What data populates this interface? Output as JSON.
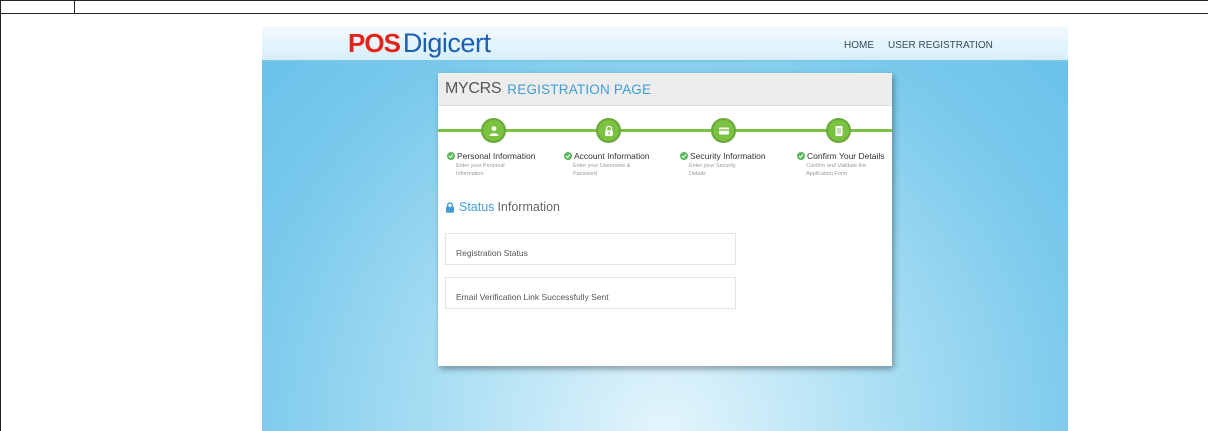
{
  "site": {
    "logo_pos": "POS",
    "logo_digicert": "Digicert"
  },
  "nav": {
    "home": "HOME",
    "user_registration": "USER REGISTRATION"
  },
  "page": {
    "title_main": "MYCRS",
    "title_sub": "REGISTRATION PAGE"
  },
  "steps": [
    {
      "title": "Personal Information",
      "desc": "Enter your Personal Information",
      "icon": "user-icon"
    },
    {
      "title": "Account Information",
      "desc": "Enter your Username & Password",
      "icon": "lock-icon"
    },
    {
      "title": "Security Information",
      "desc": "Enter your Security Details",
      "icon": "card-icon"
    },
    {
      "title": "Confirm Your Details",
      "desc": "Confirm and Validate the Application Form",
      "icon": "document-icon"
    }
  ],
  "status": {
    "heading_blue": "Status",
    "heading_gray": "Information",
    "registration_status": "Registration Status",
    "message": "Email Verification Link Successfully Sent"
  },
  "colors": {
    "accent_blue": "#3d9ed8",
    "step_green": "#7bc142",
    "logo_red": "#e2231a",
    "logo_blue": "#1a5fb4"
  }
}
